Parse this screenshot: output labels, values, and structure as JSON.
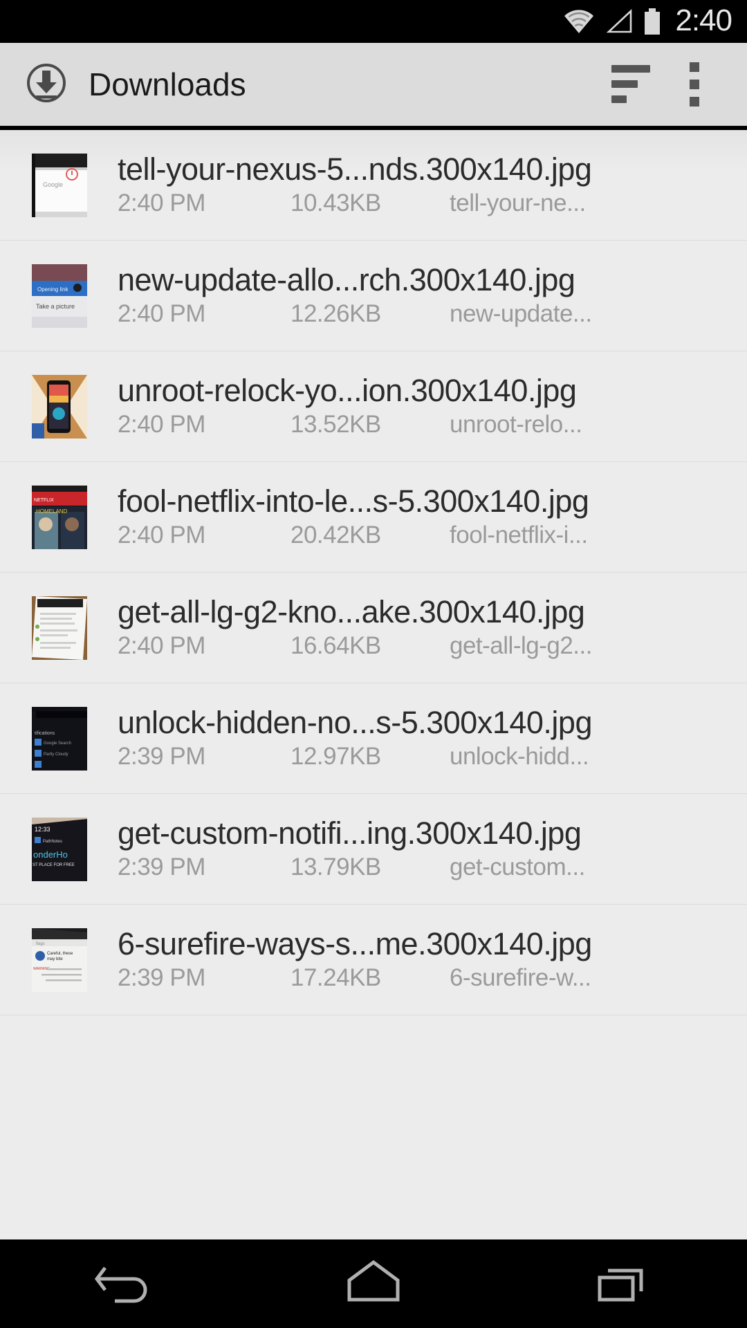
{
  "status_bar": {
    "time": "2:40",
    "icons": [
      "wifi-icon",
      "cellular-signal-icon",
      "battery-icon"
    ]
  },
  "action_bar": {
    "title": "Downloads",
    "app_icon": "download-circle-icon",
    "sort_button": "sort-icon",
    "overflow_button": "overflow-menu-icon"
  },
  "colors": {
    "status_bar_bg": "#000000",
    "action_bar_bg": "#dcdcdc",
    "list_bg": "#ececec",
    "title_text": "#1a1a1a",
    "filename_text": "#2b2b2b",
    "meta_text": "#9a9a9a",
    "divider": "#dcdcdc",
    "nav_bar_bg": "#000000",
    "nav_icon": "#b0b0b0"
  },
  "downloads": [
    {
      "filename": "tell-your-nexus-5...nds.300x140.jpg",
      "time": "2:40 PM",
      "size": "10.43KB",
      "source": "tell-your-ne...",
      "thumbnail": "google-search-screenshot-thumbnail"
    },
    {
      "filename": "new-update-allo...rch.300x140.jpg",
      "time": "2:40 PM",
      "size": "12.26KB",
      "source": "new-update...",
      "thumbnail": "take-a-picture-screenshot-thumbnail"
    },
    {
      "filename": "unroot-relock-yo...ion.300x140.jpg",
      "time": "2:40 PM",
      "size": "13.52KB",
      "source": "unroot-relo...",
      "thumbnail": "nexus-5-phone-thumbnail"
    },
    {
      "filename": "fool-netflix-into-le...s-5.300x140.jpg",
      "time": "2:40 PM",
      "size": "20.42KB",
      "source": "fool-netflix-i...",
      "thumbnail": "netflix-homeland-poster-thumbnail"
    },
    {
      "filename": "get-all-lg-g2-kno...ake.300x140.jpg",
      "time": "2:40 PM",
      "size": "16.64KB",
      "source": "get-all-lg-g2...",
      "thumbnail": "phone-on-wood-table-thumbnail"
    },
    {
      "filename": "unlock-hidden-no...s-5.300x140.jpg",
      "time": "2:39 PM",
      "size": "12.97KB",
      "source": "unlock-hidd...",
      "thumbnail": "dark-notifications-screen-thumbnail"
    },
    {
      "filename": "get-custom-notifi...ing.300x140.jpg",
      "time": "2:39 PM",
      "size": "13.79KB",
      "source": "get-custom...",
      "thumbnail": "wonderhowto-notification-thumbnail"
    },
    {
      "filename": "6-surefire-ways-s...me.300x140.jpg",
      "time": "2:39 PM",
      "size": "17.24KB",
      "source": "6-surefire-w...",
      "thumbnail": "chrome-flags-warning-thumbnail"
    }
  ],
  "nav_bar": {
    "back": "back-icon",
    "home": "home-icon",
    "recents": "recents-icon"
  }
}
